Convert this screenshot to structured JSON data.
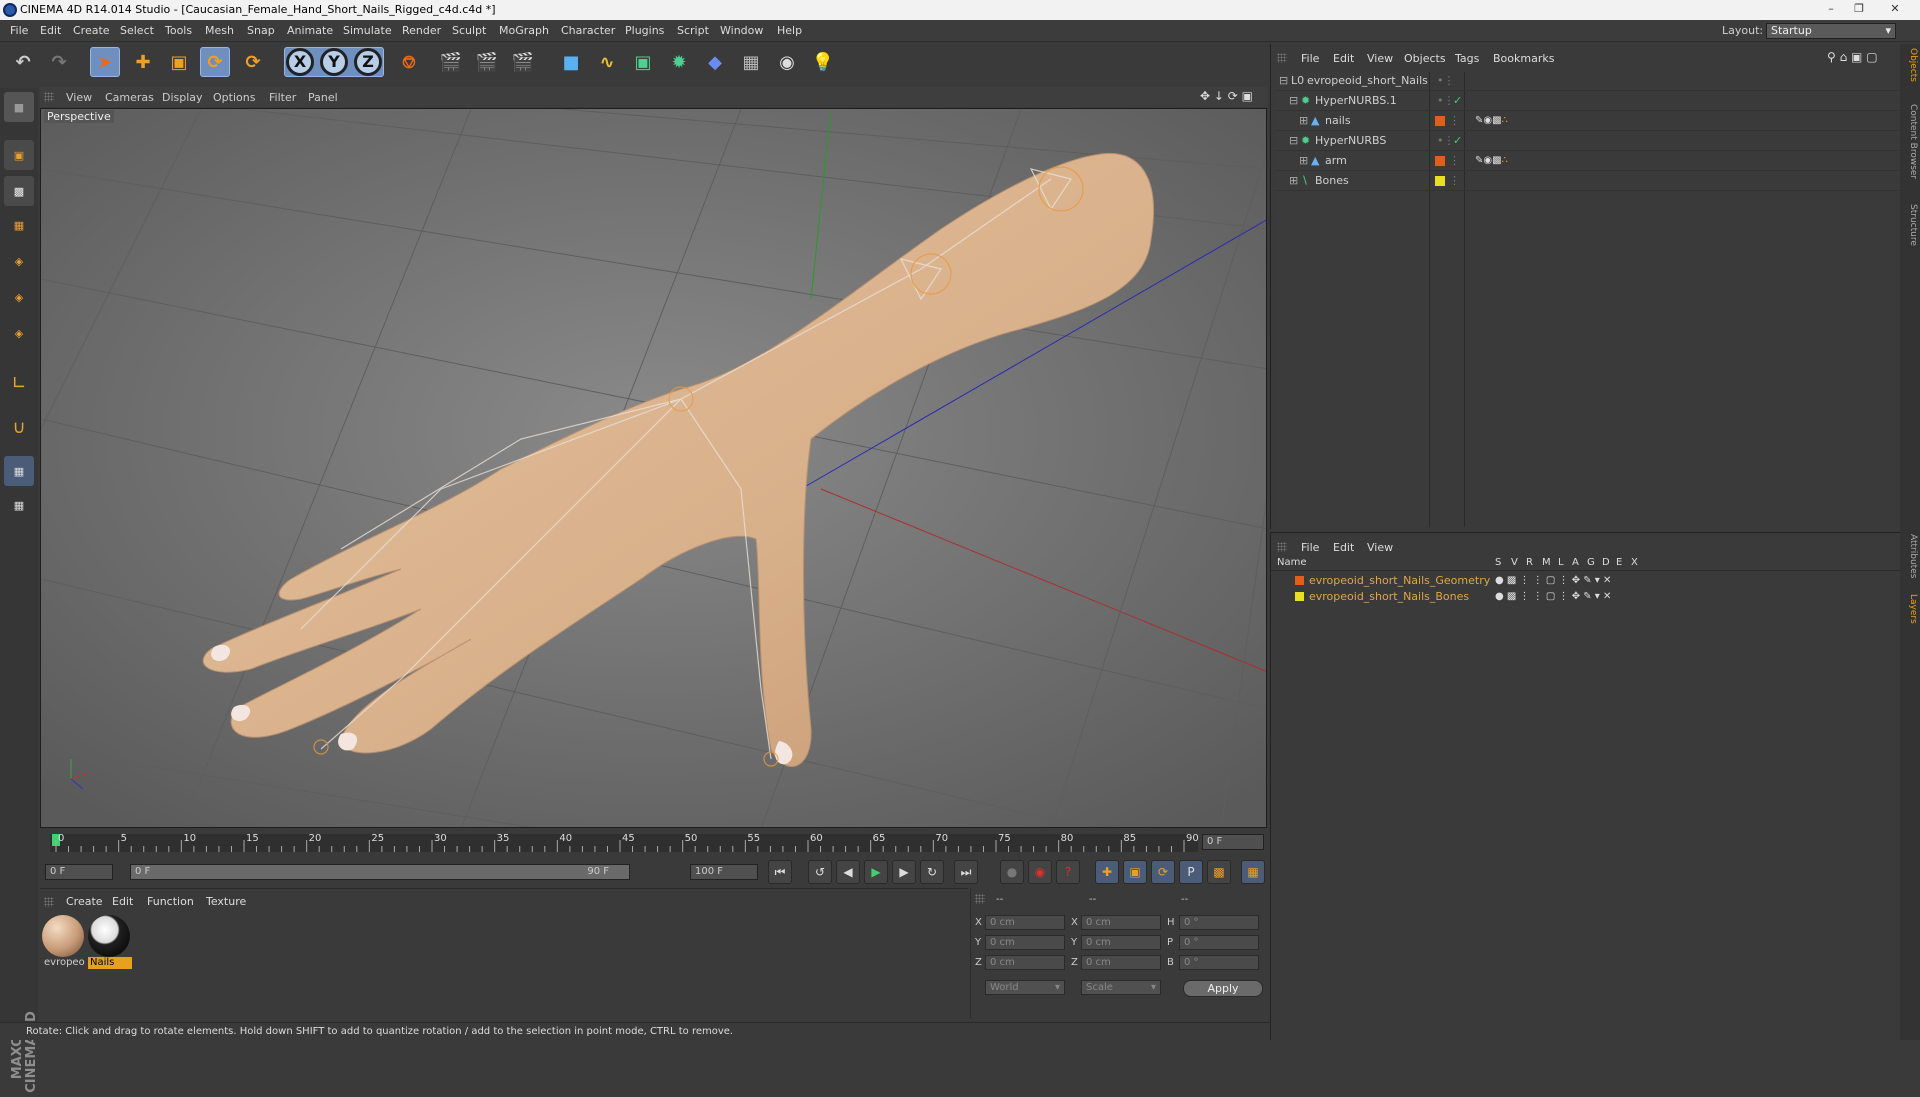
{
  "window": {
    "title": "CINEMA 4D R14.014 Studio - [Caucasian_Female_Hand_Short_Nails_Rigged_c4d.c4d *]"
  },
  "menu": [
    "File",
    "Edit",
    "Create",
    "Select",
    "Tools",
    "Mesh",
    "Snap",
    "Animate",
    "Simulate",
    "Render",
    "Sculpt",
    "MoGraph",
    "Character",
    "Plugins",
    "Script",
    "Window",
    "Help"
  ],
  "layout": {
    "label": "Layout:",
    "value": "Startup"
  },
  "viewport": {
    "menu": [
      "View",
      "Cameras",
      "Display",
      "Options",
      "Filter",
      "Panel"
    ],
    "label": "Perspective"
  },
  "timeline": {
    "ticks": [
      "0",
      "5",
      "10",
      "15",
      "20",
      "25",
      "30",
      "35",
      "40",
      "45",
      "50",
      "55",
      "60",
      "65",
      "70",
      "75",
      "80",
      "85",
      "90"
    ],
    "current": "0 F"
  },
  "playback": {
    "start": "0 F",
    "range_start": "0 F",
    "range_end": "90 F",
    "end": "100 F"
  },
  "materials": {
    "menu": [
      "Create",
      "Edit",
      "Function",
      "Texture"
    ],
    "items": [
      {
        "name": "evropeo",
        "selected": false
      },
      {
        "name": "Nails",
        "selected": true
      }
    ]
  },
  "coords": {
    "header": [
      "--",
      "--",
      "--"
    ],
    "rows": [
      {
        "a": "X",
        "av": "0 cm",
        "b": "X",
        "bv": "0 cm",
        "c": "H",
        "cv": "0 °"
      },
      {
        "a": "Y",
        "av": "0 cm",
        "b": "Y",
        "bv": "0 cm",
        "c": "P",
        "cv": "0 °"
      },
      {
        "a": "Z",
        "av": "0 cm",
        "b": "Z",
        "bv": "0 cm",
        "c": "B",
        "cv": "0 °"
      }
    ],
    "world": "World",
    "scale": "Scale",
    "apply": "Apply"
  },
  "status": "Rotate: Click and drag to rotate elements. Hold down SHIFT to add to quantize rotation / add to the selection in point mode, CTRL to remove.",
  "objects": {
    "menu": [
      "File",
      "Edit",
      "View",
      "Objects",
      "Tags",
      "Bookmarks"
    ],
    "items": [
      {
        "name": "evropeoid_short_Nails",
        "indent": 0,
        "color": ""
      },
      {
        "name": "HyperNURBS.1",
        "indent": 1,
        "color": ""
      },
      {
        "name": "nails",
        "indent": 2,
        "color": "#e0601a"
      },
      {
        "name": "HyperNURBS",
        "indent": 1,
        "color": ""
      },
      {
        "name": "arm",
        "indent": 2,
        "color": "#e0601a"
      },
      {
        "name": "Bones",
        "indent": 1,
        "color": "#e8e020"
      }
    ]
  },
  "layers": {
    "menu": [
      "File",
      "Edit",
      "View"
    ],
    "columns": [
      "Name",
      "S",
      "V",
      "R",
      "M",
      "L",
      "A",
      "G",
      "D",
      "E",
      "X"
    ],
    "items": [
      {
        "name": "evropeoid_short_Nails_Geometry",
        "color": "#e0601a"
      },
      {
        "name": "evropeoid_short_Nails_Bones",
        "color": "#e8e020"
      }
    ]
  },
  "right_tabs": [
    "Objects",
    "Content Browser",
    "Structure",
    "Attributes",
    "Layers"
  ]
}
